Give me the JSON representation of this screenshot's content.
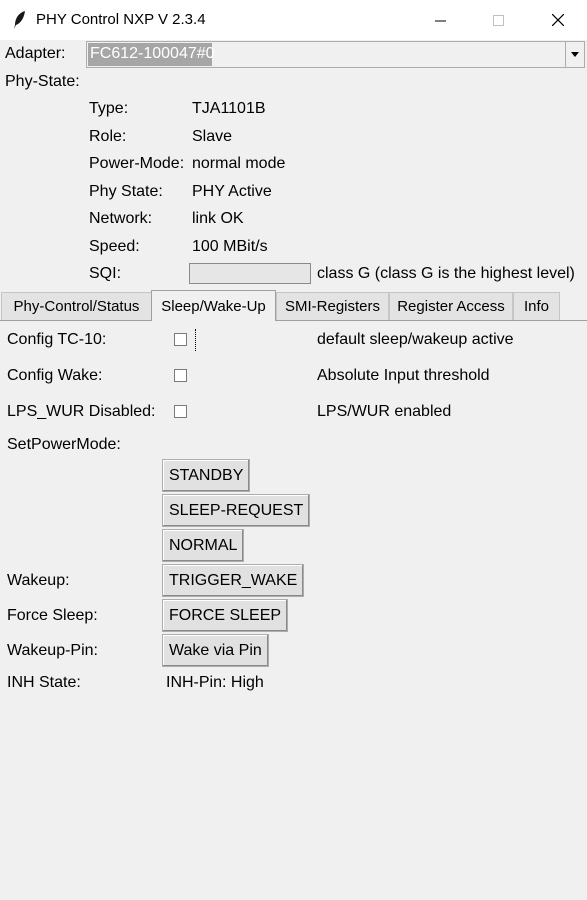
{
  "window": {
    "title": "PHY Control NXP V 2.3.4"
  },
  "adapter": {
    "label": "Adapter:",
    "value": "FC612-100047#0"
  },
  "phy_state": {
    "label": "Phy-State:",
    "rows": [
      {
        "label": "Type:",
        "value": "TJA1101B"
      },
      {
        "label": "Role:",
        "value": "Slave"
      },
      {
        "label": "Power-Mode:",
        "value": "normal mode"
      },
      {
        "label": "Phy State:",
        "value": "PHY Active"
      },
      {
        "label": "Network:",
        "value": "link OK"
      },
      {
        "label": "Speed:",
        "value": "100 MBit/s"
      }
    ],
    "sqi": {
      "label": "SQI:",
      "text": "class G (class G is the highest level)",
      "level": 0
    }
  },
  "tabs": [
    "Phy-Control/Status",
    "Sleep/Wake-Up",
    "SMI-Registers",
    "Register Access",
    "Info"
  ],
  "active_tab": "Sleep/Wake-Up",
  "sleep_wake": {
    "config_tc10": {
      "label": "Config TC-10:",
      "checked": false,
      "status": "default sleep/wakeup active"
    },
    "config_wake": {
      "label": "Config Wake:",
      "checked": false,
      "status": "Absolute Input threshold"
    },
    "lps_wur": {
      "label": "LPS_WUR Disabled:",
      "checked": false,
      "status": "LPS/WUR enabled"
    },
    "set_power_mode": {
      "label": "SetPowerMode:",
      "buttons": [
        "STANDBY",
        "SLEEP-REQUEST",
        "NORMAL"
      ]
    },
    "wakeup": {
      "label": "Wakeup:",
      "button": "TRIGGER_WAKE"
    },
    "force_sleep": {
      "label": "Force Sleep:",
      "button": "FORCE SLEEP"
    },
    "wakeup_pin": {
      "label": "Wakeup-Pin:",
      "button": "Wake via Pin"
    },
    "inh_state": {
      "label": "INH State:",
      "value": "INH-Pin: High"
    }
  }
}
